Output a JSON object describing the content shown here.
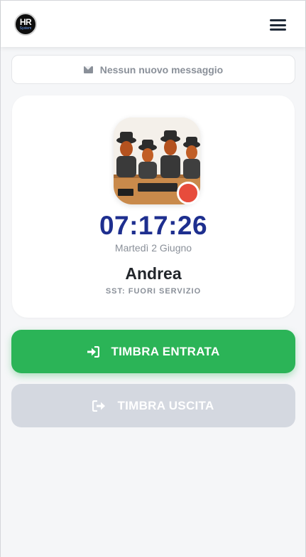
{
  "header": {
    "logo": {
      "main": "HR",
      "sub": "System"
    },
    "menu_icon": "hamburger-menu-icon"
  },
  "messages": {
    "icon": "envelope-icon",
    "text": "Nessun nuovo messaggio"
  },
  "profile": {
    "avatar": "avatar-image",
    "status_color": "#e74c3c",
    "time": "07:17:26",
    "date": "Martedì 2 Giugno",
    "name": "Andrea",
    "status_label": "SST: FUORI SERVIZIO"
  },
  "actions": {
    "clock_in": {
      "label": "TIMBRA ENTRATA",
      "icon": "sign-in-icon",
      "color": "#2bb457",
      "enabled": true
    },
    "clock_out": {
      "label": "TIMBRA USCITA",
      "icon": "sign-out-icon",
      "color": "#d4d8e0",
      "enabled": false
    }
  }
}
